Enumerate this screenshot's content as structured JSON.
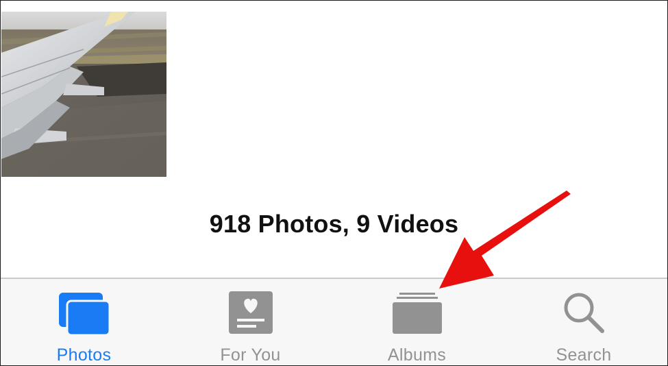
{
  "library": {
    "count_text": "918 Photos, 9 Videos"
  },
  "tabbar": {
    "active_color": "#1a7cf5",
    "inactive_color": "#929292",
    "tabs": [
      {
        "label": "Photos",
        "icon": "photos-stack-icon",
        "active": true
      },
      {
        "label": "For You",
        "icon": "for-you-heart-card-icon",
        "active": false
      },
      {
        "label": "Albums",
        "icon": "albums-stack-icon",
        "active": false
      },
      {
        "label": "Search",
        "icon": "magnifier-search-icon",
        "active": false
      }
    ]
  },
  "annotation": {
    "arrow_color": "#e8100f",
    "points_to": "Albums"
  }
}
